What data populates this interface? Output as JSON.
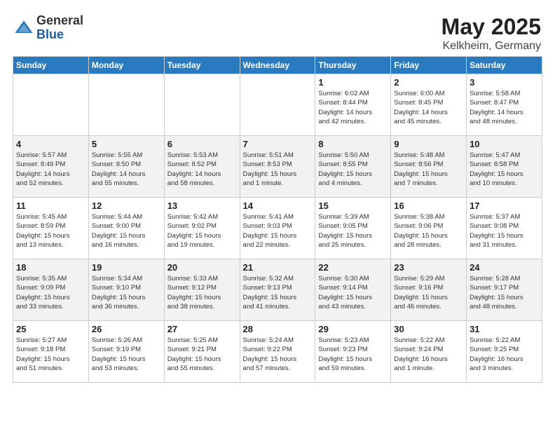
{
  "header": {
    "logo_general": "General",
    "logo_blue": "Blue",
    "month_year": "May 2025",
    "location": "Kelkheim, Germany"
  },
  "calendar": {
    "days_of_week": [
      "Sunday",
      "Monday",
      "Tuesday",
      "Wednesday",
      "Thursday",
      "Friday",
      "Saturday"
    ],
    "weeks": [
      [
        {
          "day": "",
          "info": ""
        },
        {
          "day": "",
          "info": ""
        },
        {
          "day": "",
          "info": ""
        },
        {
          "day": "",
          "info": ""
        },
        {
          "day": "1",
          "info": "Sunrise: 6:02 AM\nSunset: 8:44 PM\nDaylight: 14 hours\nand 42 minutes."
        },
        {
          "day": "2",
          "info": "Sunrise: 6:00 AM\nSunset: 8:45 PM\nDaylight: 14 hours\nand 45 minutes."
        },
        {
          "day": "3",
          "info": "Sunrise: 5:58 AM\nSunset: 8:47 PM\nDaylight: 14 hours\nand 48 minutes."
        }
      ],
      [
        {
          "day": "4",
          "info": "Sunrise: 5:57 AM\nSunset: 8:49 PM\nDaylight: 14 hours\nand 52 minutes."
        },
        {
          "day": "5",
          "info": "Sunrise: 5:55 AM\nSunset: 8:50 PM\nDaylight: 14 hours\nand 55 minutes."
        },
        {
          "day": "6",
          "info": "Sunrise: 5:53 AM\nSunset: 8:52 PM\nDaylight: 14 hours\nand 58 minutes."
        },
        {
          "day": "7",
          "info": "Sunrise: 5:51 AM\nSunset: 8:53 PM\nDaylight: 15 hours\nand 1 minute."
        },
        {
          "day": "8",
          "info": "Sunrise: 5:50 AM\nSunset: 8:55 PM\nDaylight: 15 hours\nand 4 minutes."
        },
        {
          "day": "9",
          "info": "Sunrise: 5:48 AM\nSunset: 8:56 PM\nDaylight: 15 hours\nand 7 minutes."
        },
        {
          "day": "10",
          "info": "Sunrise: 5:47 AM\nSunset: 8:58 PM\nDaylight: 15 hours\nand 10 minutes."
        }
      ],
      [
        {
          "day": "11",
          "info": "Sunrise: 5:45 AM\nSunset: 8:59 PM\nDaylight: 15 hours\nand 13 minutes."
        },
        {
          "day": "12",
          "info": "Sunrise: 5:44 AM\nSunset: 9:00 PM\nDaylight: 15 hours\nand 16 minutes."
        },
        {
          "day": "13",
          "info": "Sunrise: 5:42 AM\nSunset: 9:02 PM\nDaylight: 15 hours\nand 19 minutes."
        },
        {
          "day": "14",
          "info": "Sunrise: 5:41 AM\nSunset: 9:03 PM\nDaylight: 15 hours\nand 22 minutes."
        },
        {
          "day": "15",
          "info": "Sunrise: 5:39 AM\nSunset: 9:05 PM\nDaylight: 15 hours\nand 25 minutes."
        },
        {
          "day": "16",
          "info": "Sunrise: 5:38 AM\nSunset: 9:06 PM\nDaylight: 15 hours\nand 28 minutes."
        },
        {
          "day": "17",
          "info": "Sunrise: 5:37 AM\nSunset: 9:08 PM\nDaylight: 15 hours\nand 31 minutes."
        }
      ],
      [
        {
          "day": "18",
          "info": "Sunrise: 5:35 AM\nSunset: 9:09 PM\nDaylight: 15 hours\nand 33 minutes."
        },
        {
          "day": "19",
          "info": "Sunrise: 5:34 AM\nSunset: 9:10 PM\nDaylight: 15 hours\nand 36 minutes."
        },
        {
          "day": "20",
          "info": "Sunrise: 5:33 AM\nSunset: 9:12 PM\nDaylight: 15 hours\nand 38 minutes."
        },
        {
          "day": "21",
          "info": "Sunrise: 5:32 AM\nSunset: 9:13 PM\nDaylight: 15 hours\nand 41 minutes."
        },
        {
          "day": "22",
          "info": "Sunrise: 5:30 AM\nSunset: 9:14 PM\nDaylight: 15 hours\nand 43 minutes."
        },
        {
          "day": "23",
          "info": "Sunrise: 5:29 AM\nSunset: 9:16 PM\nDaylight: 15 hours\nand 46 minutes."
        },
        {
          "day": "24",
          "info": "Sunrise: 5:28 AM\nSunset: 9:17 PM\nDaylight: 15 hours\nand 48 minutes."
        }
      ],
      [
        {
          "day": "25",
          "info": "Sunrise: 5:27 AM\nSunset: 9:18 PM\nDaylight: 15 hours\nand 51 minutes."
        },
        {
          "day": "26",
          "info": "Sunrise: 5:26 AM\nSunset: 9:19 PM\nDaylight: 15 hours\nand 53 minutes."
        },
        {
          "day": "27",
          "info": "Sunrise: 5:25 AM\nSunset: 9:21 PM\nDaylight: 15 hours\nand 55 minutes."
        },
        {
          "day": "28",
          "info": "Sunrise: 5:24 AM\nSunset: 9:22 PM\nDaylight: 15 hours\nand 57 minutes."
        },
        {
          "day": "29",
          "info": "Sunrise: 5:23 AM\nSunset: 9:23 PM\nDaylight: 15 hours\nand 59 minutes."
        },
        {
          "day": "30",
          "info": "Sunrise: 5:22 AM\nSunset: 9:24 PM\nDaylight: 16 hours\nand 1 minute."
        },
        {
          "day": "31",
          "info": "Sunrise: 5:22 AM\nSunset: 9:25 PM\nDaylight: 16 hours\nand 3 minutes."
        }
      ]
    ]
  }
}
